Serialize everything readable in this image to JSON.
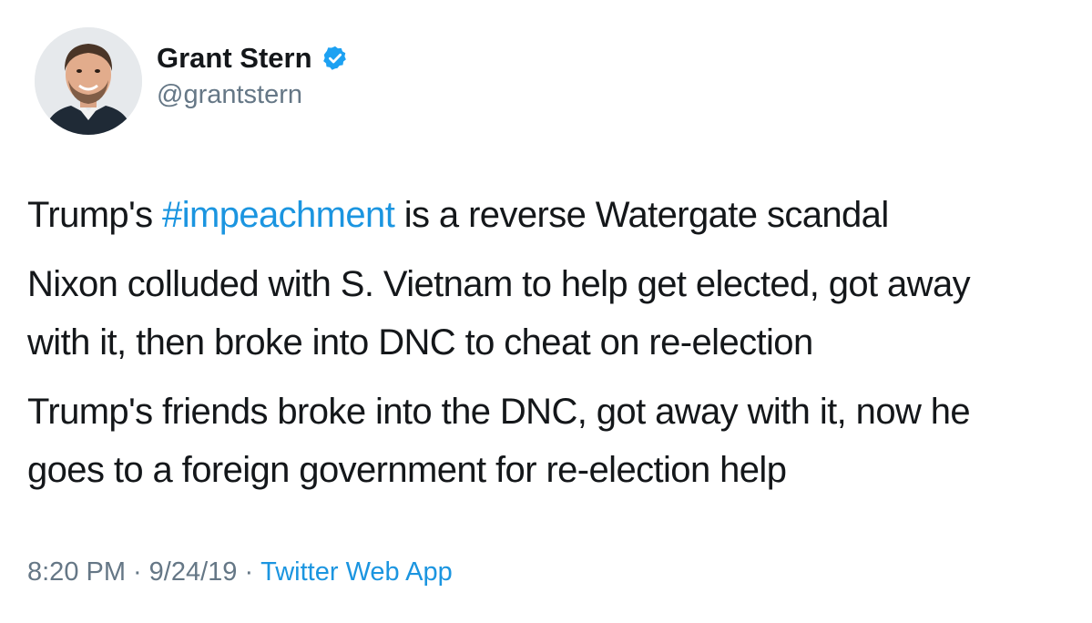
{
  "author": {
    "display_name": "Grant Stern",
    "handle": "@grantstern",
    "verified_icon": "verified-badge-icon",
    "avatar_icon": "profile-photo"
  },
  "tweet": {
    "p1_before": "Trump's ",
    "p1_hashtag": "#impeachment",
    "p1_after": " is a reverse Watergate scandal",
    "p2_line1": "Nixon colluded with S. Vietnam to help get elected, got away",
    "p2_line2": "with it, then broke into DNC to cheat on re-election",
    "p3_line1": "Trump's friends broke into the DNC, got away with it, now he",
    "p3_line2": "goes to a foreign government for re-election help"
  },
  "meta": {
    "time": "8:20 PM",
    "separator": "·",
    "date": "9/24/19",
    "source": "Twitter Web App"
  },
  "colors": {
    "text": "#14171a",
    "secondary": "#657786",
    "link": "#1b95e0"
  }
}
